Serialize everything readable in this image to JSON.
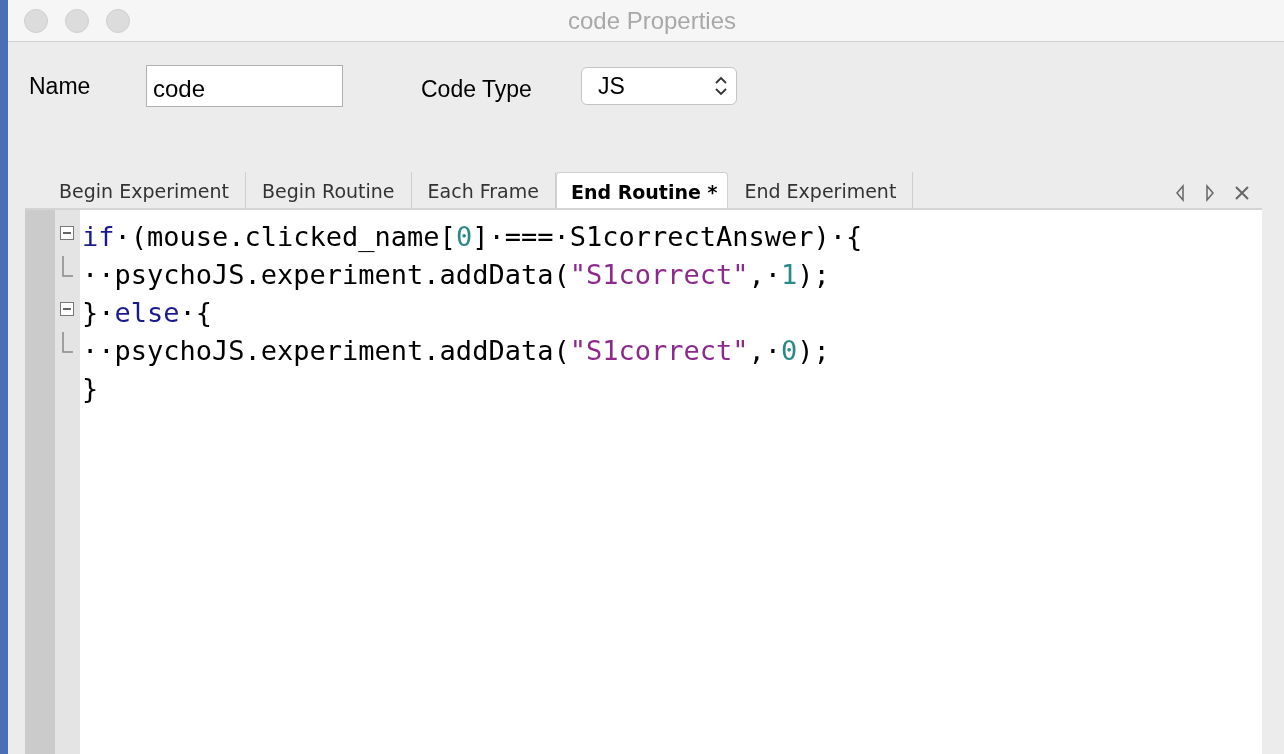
{
  "window": {
    "title": "code Properties"
  },
  "form": {
    "name_label": "Name",
    "name_value": "code",
    "type_label": "Code Type",
    "type_value": "JS"
  },
  "tabs": [
    {
      "label": "Begin Experiment",
      "selected": false
    },
    {
      "label": "Begin Routine",
      "selected": false
    },
    {
      "label": "Each Frame",
      "selected": false
    },
    {
      "label": "End Routine *",
      "selected": true
    },
    {
      "label": "End Experiment",
      "selected": false
    }
  ],
  "code_lines": [
    {
      "kind": "open",
      "tokens": [
        {
          "kind": "keyword",
          "text": "if"
        },
        {
          "kind": "plain",
          "text": "·(mouse.clicked_name["
        },
        {
          "kind": "number",
          "text": "0"
        },
        {
          "kind": "plain",
          "text": "]·===·S1correctAnswer)·{"
        }
      ]
    },
    {
      "kind": "end",
      "tokens": [
        {
          "kind": "plain",
          "text": "··psychoJS.experiment.addData("
        },
        {
          "kind": "string",
          "text": "\"S1correct\""
        },
        {
          "kind": "plain",
          "text": ",·"
        },
        {
          "kind": "number",
          "text": "1"
        },
        {
          "kind": "plain",
          "text": ");"
        }
      ]
    },
    {
      "kind": "open",
      "tokens": [
        {
          "kind": "plain",
          "text": "}·"
        },
        {
          "kind": "keyword",
          "text": "else"
        },
        {
          "kind": "plain",
          "text": "·{"
        }
      ]
    },
    {
      "kind": "end",
      "tokens": [
        {
          "kind": "plain",
          "text": "··psychoJS.experiment.addData("
        },
        {
          "kind": "string",
          "text": "\"S1correct\""
        },
        {
          "kind": "plain",
          "text": ",·"
        },
        {
          "kind": "number",
          "text": "0"
        },
        {
          "kind": "plain",
          "text": ");"
        }
      ]
    },
    {
      "kind": "plain",
      "tokens": [
        {
          "kind": "plain",
          "text": "}"
        }
      ]
    }
  ]
}
